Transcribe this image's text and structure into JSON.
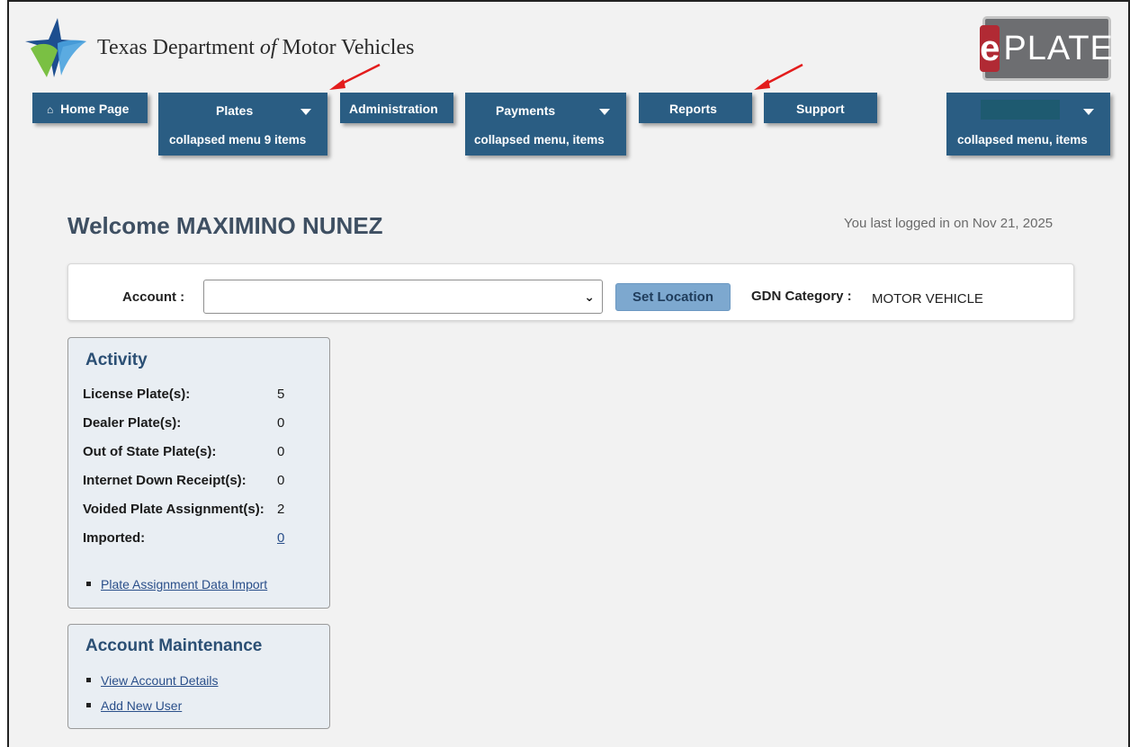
{
  "header": {
    "org_name_part1": "Texas Department ",
    "org_name_of": "of",
    "org_name_part2": " Motor Vehicles",
    "eplate_logo": "ePLATE",
    "eplate_e": "e",
    "eplate_rest": "PLATE"
  },
  "nav": {
    "home": {
      "label": "Home Page",
      "icon": "home-icon"
    },
    "plates": {
      "label": "Plates",
      "sub": "collapsed menu 9 items"
    },
    "administration": {
      "label": "Administration"
    },
    "payments": {
      "label": "Payments",
      "sub": "collapsed menu, items"
    },
    "reports": {
      "label": "Reports"
    },
    "support": {
      "label": "Support"
    },
    "user": {
      "sub": "collapsed menu, items"
    }
  },
  "welcome": {
    "title": "Welcome MAXIMINO NUNEZ",
    "last_login": "You last logged in on Nov 21, 2025"
  },
  "account_bar": {
    "account_label": "Account :",
    "account_value": "",
    "set_location": "Set Location",
    "gdn_label": "GDN Category :",
    "gdn_value": "MOTOR VEHICLE"
  },
  "activity": {
    "title": "Activity",
    "stats": [
      {
        "label": "License Plate(s):",
        "value": "5"
      },
      {
        "label": "Dealer Plate(s):",
        "value": "0"
      },
      {
        "label": "Out of State Plate(s):",
        "value": "0"
      },
      {
        "label": "Internet Down Receipt(s):",
        "value": "0"
      },
      {
        "label": "Voided Plate Assignment(s):",
        "value": "2"
      },
      {
        "label": "Imported:",
        "value": "0"
      }
    ],
    "links": [
      "Plate Assignment Data Import"
    ]
  },
  "account_maintenance": {
    "title": "Account Maintenance",
    "links": [
      "View Account Details",
      "Add New User"
    ]
  },
  "colors": {
    "nav_blue": "#2a5d83",
    "title_blue": "#2b4f74",
    "annotation_red": "#e31c1c",
    "eplate_red": "#b12a34"
  }
}
